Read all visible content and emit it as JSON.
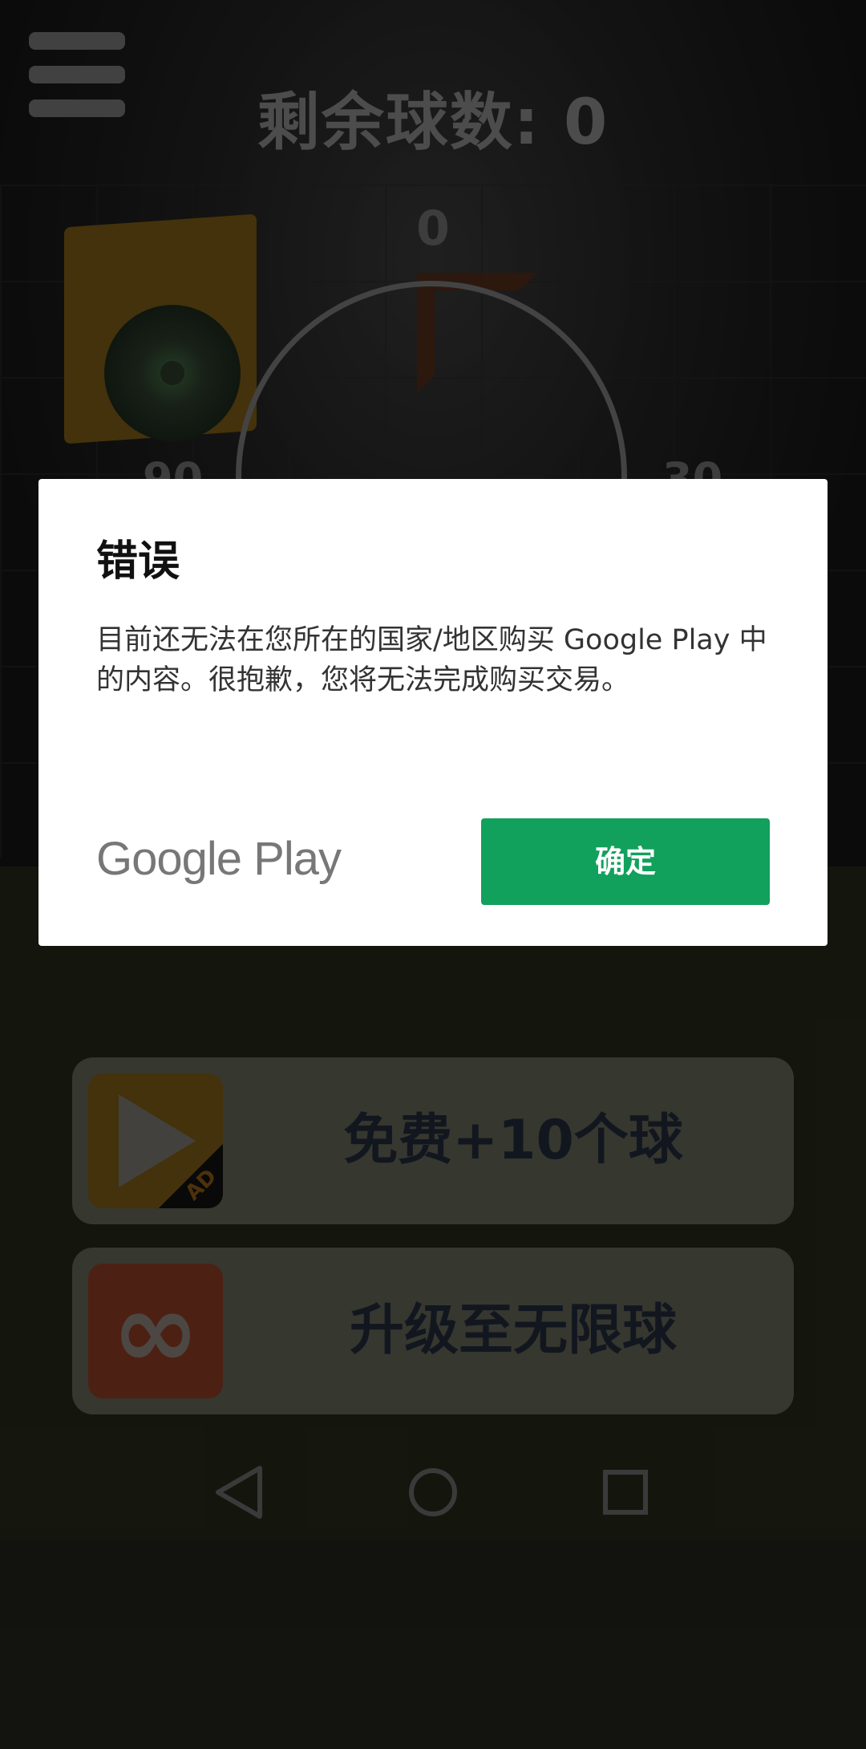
{
  "game": {
    "balls_remaining_label": "剩余球数: 0",
    "score_top": "0",
    "left_value": "90",
    "right_value": "30",
    "menu_icon": "hamburger-menu-icon"
  },
  "ctas": [
    {
      "label": "免费+10个球",
      "icon": "play-ad-icon",
      "icon_color": "#7a5c14",
      "ad_tag": "AD"
    },
    {
      "label": "升级至无限球",
      "icon": "infinity-icon",
      "icon_color": "#8c3b26",
      "symbol": "∞"
    }
  ],
  "dialog": {
    "title": "错误",
    "message": "目前还无法在您所在的国家/地区购买 Google Play 中的内容。很抱歉，您将无法完成购买交易。",
    "logo_text": "Google Play",
    "ok_label": "确定",
    "ok_color": "#12a05d"
  },
  "navbar": {
    "back_icon": "back-triangle-icon",
    "home_icon": "home-circle-icon",
    "recents_icon": "recents-square-icon"
  }
}
